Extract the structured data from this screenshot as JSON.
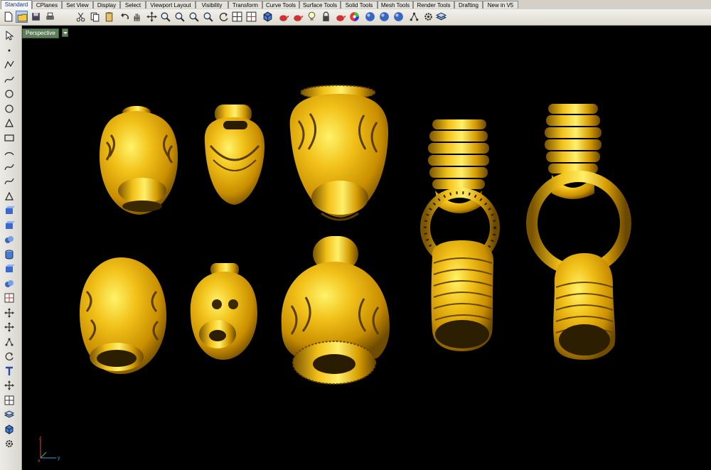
{
  "tabs": [
    {
      "label": "Standard",
      "active": true
    },
    {
      "label": "CPlanes",
      "active": false
    },
    {
      "label": "Set View",
      "active": false
    },
    {
      "label": "Display",
      "active": false
    },
    {
      "label": "Select",
      "active": false
    },
    {
      "label": "Viewport Layout",
      "active": false
    },
    {
      "label": "Visibility",
      "active": false
    },
    {
      "label": "Transform",
      "active": false
    },
    {
      "label": "Curve Tools",
      "active": false
    },
    {
      "label": "Surface Tools",
      "active": false
    },
    {
      "label": "Solid Tools",
      "active": false
    },
    {
      "label": "Mesh Tools",
      "active": false
    },
    {
      "label": "Render Tools",
      "active": false
    },
    {
      "label": "Drafting",
      "active": false
    },
    {
      "label": "New in V5",
      "active": false
    }
  ],
  "toolbar_icons": [
    "new-file-icon",
    "open-file-icon",
    "save-icon",
    "print-icon",
    "cut-icon",
    "copy-icon",
    "paste-icon",
    "undo-icon",
    "pan-hand-icon",
    "pan-move-icon",
    "zoom-dynamic-icon",
    "zoom-window-icon",
    "zoom-extents-icon",
    "zoom-selected-icon",
    "rotate-view-icon",
    "four-viewports-icon",
    "grid-options-icon",
    "shaded-display-icon",
    "object-properties-icon",
    "properties-icon",
    "light-bulb-icon",
    "lock-icon",
    "render-settings-icon",
    "color-wheel-icon",
    "material-sphere-icon",
    "render-sphere-icon",
    "environment-sphere-icon",
    "edit-points-icon",
    "options-gear-icon",
    "layer-icon"
  ],
  "left_icons": [
    "select-arrow-icon",
    "point-icon",
    "polyline-icon",
    "curve-control-points-icon",
    "circle-icon",
    "ellipse-icon",
    "polygon-icon",
    "rectangle-icon",
    "arc-icon",
    "fillet-curve-icon",
    "offset-curve-icon",
    "surface-from-curves-icon",
    "extrude-surface-icon",
    "box-solid-icon",
    "sphere-solid-icon",
    "cylinder-solid-icon",
    "mesh-box-icon",
    "boolean-union-icon",
    "explode-icon",
    "split-icon",
    "trim-icon",
    "join-icon",
    "rebuild-icon",
    "text-icon",
    "transform-move-icon",
    "array-icon",
    "group-icon",
    "analyze-icon",
    "options-icon"
  ],
  "viewport": {
    "title": "Perspective",
    "background": "#000000"
  },
  "axes": {
    "x": "x",
    "y": "y",
    "z": "z"
  },
  "colors": {
    "gold": "#e0a800",
    "gold_light": "#fff36a",
    "gold_dark": "#7a5400",
    "tab_active": "#1a3a8a",
    "viewport_label": "#5e7e5a"
  }
}
